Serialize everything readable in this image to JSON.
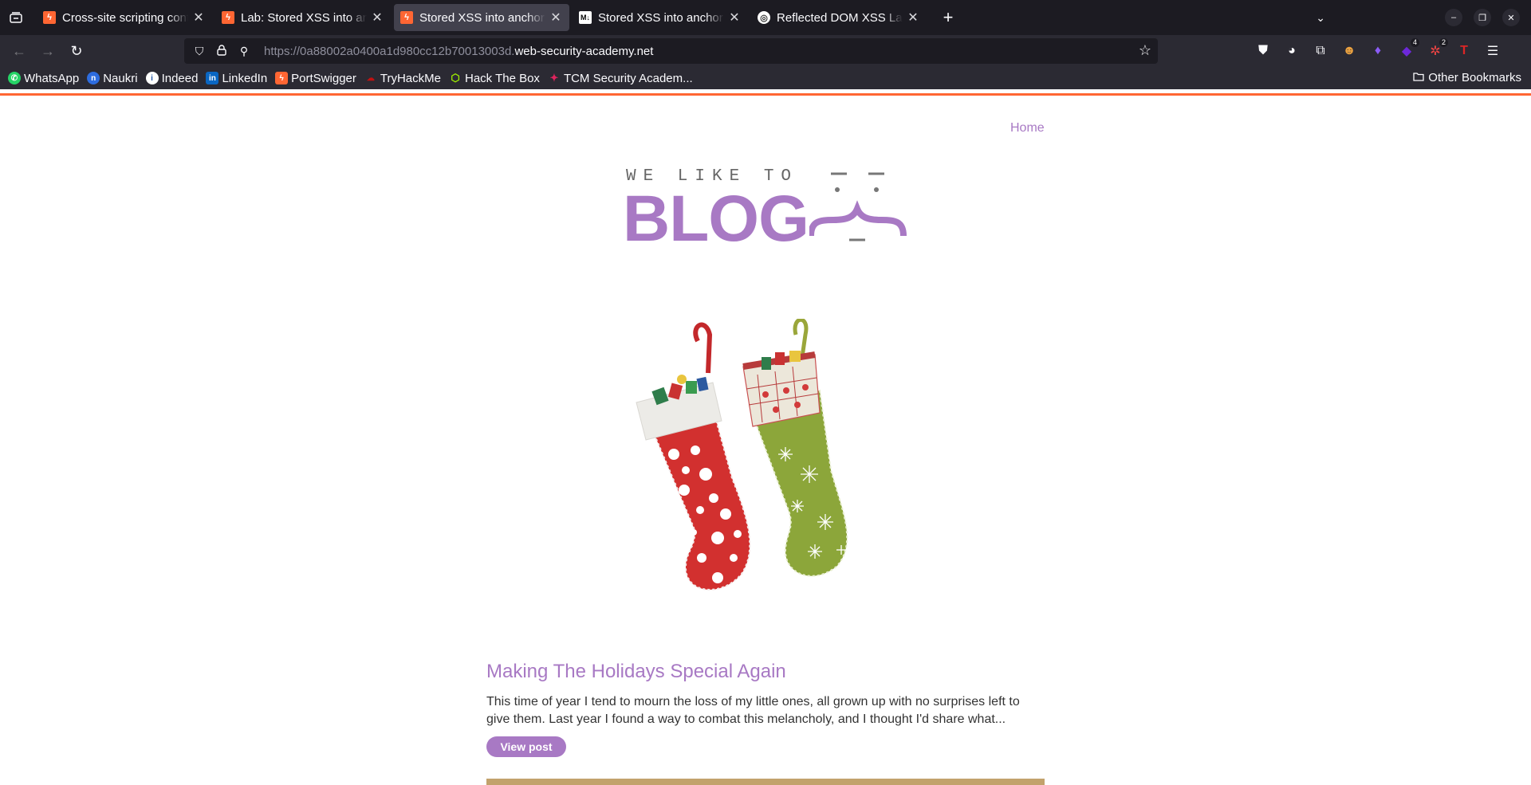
{
  "browser": {
    "tabs": [
      {
        "title": "Cross-site scripting conte",
        "favicon": "portswigger-icon",
        "active": false
      },
      {
        "title": "Lab: Stored XSS into anch",
        "favicon": "portswigger-icon",
        "active": false
      },
      {
        "title": "Stored XSS into anchor hr",
        "favicon": "portswigger-icon",
        "active": true
      },
      {
        "title": "Stored XSS into anchor hr",
        "favicon": "medium-icon",
        "active": false
      },
      {
        "title": "Reflected DOM XSS Lab",
        "favicon": "globe-icon",
        "active": false
      }
    ],
    "url": {
      "prefix": "https://0a88002a0400a1d980cc12b70013003d.",
      "domain": "web-security-academy.net"
    },
    "bookmarks": [
      {
        "label": "WhatsApp",
        "icon": "whatsapp-icon",
        "color": "#25d366"
      },
      {
        "label": "Naukri",
        "icon": "naukri-icon",
        "color": "#2d6cdf"
      },
      {
        "label": "Indeed",
        "icon": "indeed-icon",
        "color": "#ffffff"
      },
      {
        "label": "LinkedIn",
        "icon": "linkedin-icon",
        "color": "#0a66c2"
      },
      {
        "label": "PortSwigger",
        "icon": "portswigger-icon",
        "color": "#ff6633"
      },
      {
        "label": "TryHackMe",
        "icon": "tryhackme-icon",
        "color": "#c11111"
      },
      {
        "label": "Hack The Box",
        "icon": "hackthebox-icon",
        "color": "#9fef00"
      },
      {
        "label": "TCM Security Academ...",
        "icon": "tcm-icon",
        "color": "#e0245e"
      }
    ],
    "other_bookmarks": "Other Bookmarks",
    "extension_badges": {
      "ext4": "4",
      "ext5": "2"
    },
    "accent_color": "#ff6633"
  },
  "page": {
    "nav": {
      "home": "Home"
    },
    "logo": {
      "small": "WE LIKE TO",
      "big": "BLOG"
    },
    "post": {
      "title": "Making The Holidays Special Again",
      "summary": "This time of year I tend to mourn the loss of my little ones, all grown up with no surprises left to give them. Last year I found a way to combat this melancholy, and I thought I'd share what...",
      "button": "View post"
    },
    "brand_color": "#a879c4"
  }
}
